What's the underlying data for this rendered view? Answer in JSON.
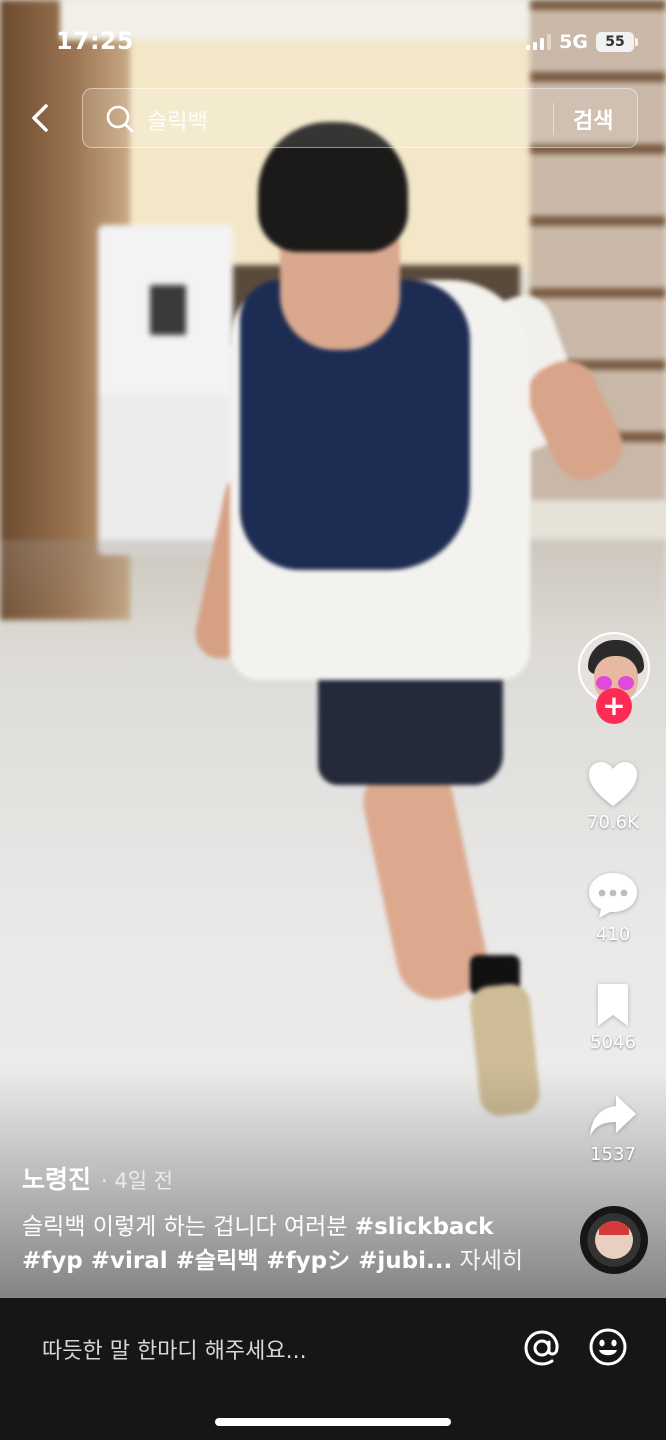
{
  "status_bar": {
    "time": "17:25",
    "network": "5G",
    "battery": "55"
  },
  "search": {
    "query": "슬릭백",
    "button_label": "검색"
  },
  "video": {
    "author": "노령진",
    "posted": "· 4일 전",
    "caption_text": "슬릭백 이렇게 하는 겁니다 여러분 ",
    "caption_tags_line1": "#slickback",
    "caption_tags_line2": "#fyp #viral #슬릭백 #fypシ #jubi...",
    "more_label": "자세히"
  },
  "actions": {
    "follow_symbol": "+",
    "likes": "70.6K",
    "comments": "410",
    "saves": "5046",
    "shares": "1537"
  },
  "comment_bar": {
    "placeholder": "따듯한 말 한마디 해주세요..."
  },
  "icons": [
    "back-arrow-icon",
    "search-icon",
    "heart-icon",
    "comment-icon",
    "bookmark-icon",
    "share-icon",
    "mention-icon",
    "emoji-icon"
  ],
  "colors": {
    "accent": "#fe2c55",
    "comment_bar_bg": "#161616"
  }
}
